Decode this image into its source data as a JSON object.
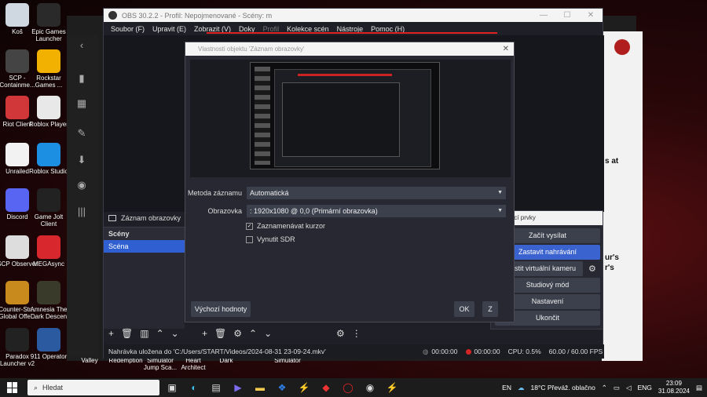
{
  "desktop_icons": [
    {
      "label": "Koš",
      "icon": "recycle-bin-icon",
      "color": "#cfd8e0"
    },
    {
      "label": "Epic Games Launcher",
      "icon": "epic-games-icon",
      "color": "#2a2a2a"
    },
    {
      "label": "SCP - Containme...",
      "icon": "scp-icon",
      "color": "#444"
    },
    {
      "label": "Rockstar Games ...",
      "icon": "rockstar-icon",
      "color": "#f2b100"
    },
    {
      "label": "Riot Client",
      "icon": "riot-icon",
      "color": "#d13639"
    },
    {
      "label": "Roblox Player",
      "icon": "roblox-icon",
      "color": "#e8e8e8"
    },
    {
      "label": "Unrailed",
      "icon": "file-icon",
      "color": "#f2f2f2"
    },
    {
      "label": "Roblox Studio",
      "icon": "roblox-studio-icon",
      "color": "#1d8fe3"
    },
    {
      "label": "Discord",
      "icon": "discord-icon",
      "color": "#5865f2"
    },
    {
      "label": "Game Jolt Client",
      "icon": "gamejolt-icon",
      "color": "#222"
    },
    {
      "label": "SCP Observer",
      "icon": "scp-observer-icon",
      "color": "#ddd"
    },
    {
      "label": "MEGAsync",
      "icon": "mega-icon",
      "color": "#d9272e"
    },
    {
      "label": "Counter-Str... Global Offe...",
      "icon": "csgo-icon",
      "color": "#c98a1d"
    },
    {
      "label": "Amnesia The Dark Descen",
      "icon": "amnesia-icon",
      "color": "#3a3a2a"
    },
    {
      "label": "Paradox Launcher v2",
      "icon": "paradox-icon",
      "color": "#222"
    },
    {
      "label": "911 Operator",
      "icon": "911-operator-icon",
      "color": "#2c5aa0"
    }
  ],
  "bottom_icons": [
    "Valley",
    "Redemption",
    "Simulator Jump Sca...",
    "Heart Architect",
    "Dark",
    "Simulator"
  ],
  "browser_right_text": [
    "s at",
    "ur's",
    "r's"
  ],
  "obs": {
    "title": "OBS 30.2.2 - Profil: Nepojmenované - Scény: m",
    "menu": [
      "Soubor (F)",
      "Upravit (E)",
      "Zobrazit (V)",
      "Doky",
      "Profil",
      "Kolekce scén",
      "Nástroje",
      "Pomoc (H)"
    ],
    "source_name": "Záznam obrazovky",
    "scenes_header": "Scény",
    "scene_item": "Scéna",
    "status": {
      "message": "Nahrávka uložena do 'C:/Users/START/Videos/2024-08-31 23-09-24.mkv'",
      "stream_time": "00:00:00",
      "rec_time": "00:00:00",
      "cpu": "CPU: 0.5%",
      "fps": "60.00 / 60.00 FPS"
    }
  },
  "controls": {
    "header": "Ovládací prvky",
    "buttons": [
      "Začít vysílat",
      "Zastavit nahrávání",
      "Spustit virtuální kameru",
      "Studiový mód",
      "Nastavení",
      "Ukončit"
    ]
  },
  "dialog": {
    "title": "Vlastnosti objektu 'Záznam obrazovky'",
    "method_label": "Metoda záznamu",
    "method_value": "Automatická",
    "display_label": "Obrazovka",
    "display_value": ": 1920x1080 @ 0,0 (Primární obrazovka)",
    "cursor_label": "Zaznamenávat kurzor",
    "cursor_checked": true,
    "sdr_label": "Vynutit SDR",
    "sdr_checked": false,
    "defaults_button": "Výchozí hodnoty",
    "ok_button": "OK",
    "cancel_button": "Z"
  },
  "taskbar": {
    "search_placeholder": "Hledat",
    "lang": "EN",
    "weather": "18°C  Převáž. oblačno",
    "lang2": "ENG",
    "time": "23:09",
    "date": "31.08.2024"
  }
}
